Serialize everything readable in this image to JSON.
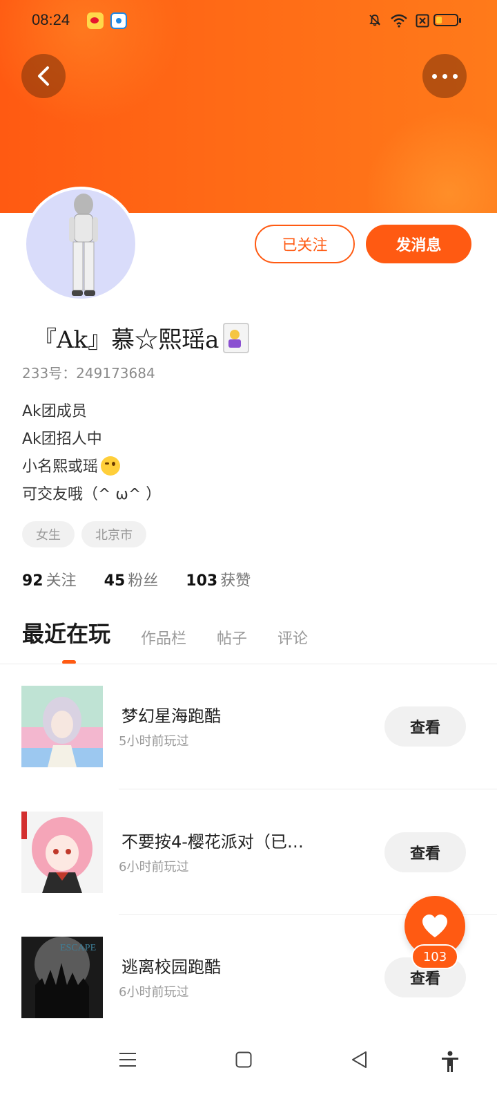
{
  "status_bar": {
    "time": "08:24"
  },
  "header": {
    "back_icon": "chevron-left-icon",
    "more_icon": "more-horizontal-icon"
  },
  "profile": {
    "nickname": "『Ak』慕☆熙瑶a",
    "uid": "233号：249173684",
    "follow_label": "已关注",
    "message_label": "发消息",
    "bio_lines": [
      "Ak团成员",
      "Ak团招人中",
      "小名熙或瑶",
      "可交友哦（^ ω^ ）"
    ],
    "tags": [
      "女生",
      "北京市"
    ],
    "stats": [
      {
        "num": "92",
        "label": "关注"
      },
      {
        "num": "45",
        "label": "粉丝"
      },
      {
        "num": "103",
        "label": "获赞"
      }
    ]
  },
  "tabs": [
    {
      "label": "最近在玩",
      "active": true
    },
    {
      "label": "作品栏",
      "active": false
    },
    {
      "label": "帖子",
      "active": false
    },
    {
      "label": "评论",
      "active": false
    }
  ],
  "games": [
    {
      "title": "梦幻星海跑酷",
      "time": "5小时前玩过",
      "button": "查看"
    },
    {
      "title": "不要按4-樱花派对（已…",
      "time": "6小时前玩过",
      "button": "查看"
    },
    {
      "title": "逃离校园跑酷",
      "time": "6小时前玩过",
      "button": "查看",
      "thumb_text": "ESCAPE"
    }
  ],
  "like_fab": {
    "count": "103",
    "icon": "heart-icon"
  },
  "colors": {
    "accent": "#ff5a12",
    "header_end": "#ff7a1a"
  }
}
